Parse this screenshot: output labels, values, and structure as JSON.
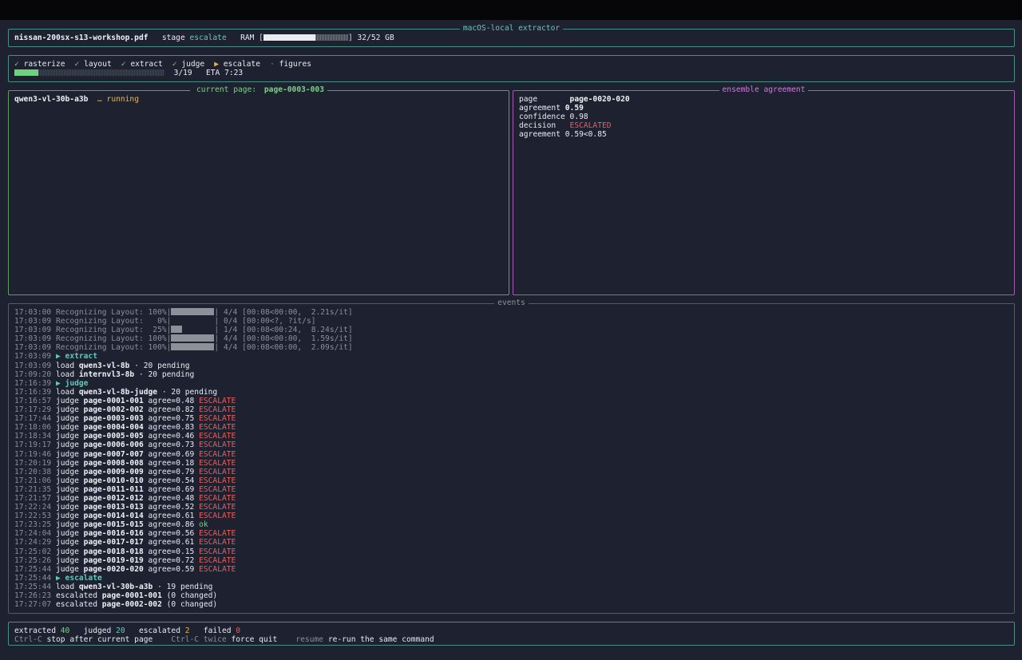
{
  "header": {
    "box_title": "macOS-local extractor",
    "filename": "nissan-200sx-s13-workshop.pdf",
    "stage_label": "stage",
    "stage_value": "escalate",
    "ram_label": "RAM",
    "ram_fraction": 0.615,
    "ram_text": "32/52 GB"
  },
  "stages": [
    {
      "mark": "✓",
      "name": "rasterize",
      "status": "done"
    },
    {
      "mark": "✓",
      "name": "layout",
      "status": "done"
    },
    {
      "mark": "✓",
      "name": "extract",
      "status": "done"
    },
    {
      "mark": "✓",
      "name": "judge",
      "status": "done"
    },
    {
      "mark": "▶",
      "name": "escalate",
      "status": "active"
    },
    {
      "mark": "·",
      "name": "figures",
      "status": "pending"
    }
  ],
  "progress": {
    "fraction": 0.158,
    "count": "3/19",
    "eta": "ETA 7:23"
  },
  "current": {
    "title_prefix": "current page:",
    "page": "page-0003-003",
    "model": "qwen3-vl-30b-a3b",
    "spinner": "…",
    "status": "running"
  },
  "ensemble": {
    "title": "ensemble agreement",
    "page_label": "page",
    "page_value": "page-0020-020",
    "agreement_label": "agreement",
    "agreement_value": "0.59",
    "confidence_label": "confidence",
    "confidence_value": "0.98",
    "decision_label": "decision",
    "decision_value": "ESCALATED",
    "threshold_label": "agreement",
    "threshold_value": "0.59<0.85"
  },
  "events": {
    "title": "events",
    "progress_lines": [
      {
        "time": "17:03:00",
        "label": "Recognizing Layout:",
        "pct": "100%",
        "fraction": 1.0,
        "tail": "4/4 [00:08<00:00,  2.21s/it]"
      },
      {
        "time": "17:03:09",
        "label": "Recognizing Layout:",
        "pct": "  0%",
        "fraction": 0.0,
        "tail": "0/4 [00:00<?, ?it/s]"
      },
      {
        "time": "17:03:09",
        "label": "Recognizing Layout:",
        "pct": " 25%",
        "fraction": 0.25,
        "tail": "1/4 [00:08<00:24,  8.24s/it]"
      },
      {
        "time": "17:03:09",
        "label": "Recognizing Layout:",
        "pct": "100%",
        "fraction": 1.0,
        "tail": "4/4 [00:08<00:00,  1.59s/it]"
      },
      {
        "time": "17:03:09",
        "label": "Recognizing Layout:",
        "pct": "100%",
        "fraction": 1.0,
        "tail": "4/4 [00:08<00:00,  2.09s/it]"
      }
    ],
    "log": [
      {
        "type": "stage",
        "time": "17:03:09",
        "text": "▶ extract"
      },
      {
        "type": "load",
        "time": "17:03:09",
        "model": "qwen3-vl-8b",
        "tail": "· 20 pending"
      },
      {
        "type": "load",
        "time": "17:09:20",
        "model": "internvl3-8b",
        "tail": "· 20 pending"
      },
      {
        "type": "stage",
        "time": "17:16:39",
        "text": "▶ judge"
      },
      {
        "type": "load",
        "time": "17:16:39",
        "model": "qwen3-vl-8b-judge",
        "tail": "· 20 pending"
      },
      {
        "type": "judge",
        "time": "17:16:57",
        "page": "page-0001-001",
        "agree": "agree=0.48",
        "verdict": "ESCALATE"
      },
      {
        "type": "judge",
        "time": "17:17:29",
        "page": "page-0002-002",
        "agree": "agree=0.82",
        "verdict": "ESCALATE"
      },
      {
        "type": "judge",
        "time": "17:17:44",
        "page": "page-0003-003",
        "agree": "agree=0.75",
        "verdict": "ESCALATE"
      },
      {
        "type": "judge",
        "time": "17:18:06",
        "page": "page-0004-004",
        "agree": "agree=0.83",
        "verdict": "ESCALATE"
      },
      {
        "type": "judge",
        "time": "17:18:34",
        "page": "page-0005-005",
        "agree": "agree=0.46",
        "verdict": "ESCALATE"
      },
      {
        "type": "judge",
        "time": "17:19:17",
        "page": "page-0006-006",
        "agree": "agree=0.73",
        "verdict": "ESCALATE"
      },
      {
        "type": "judge",
        "time": "17:19:46",
        "page": "page-0007-007",
        "agree": "agree=0.69",
        "verdict": "ESCALATE"
      },
      {
        "type": "judge",
        "time": "17:20:19",
        "page": "page-0008-008",
        "agree": "agree=0.18",
        "verdict": "ESCALATE"
      },
      {
        "type": "judge",
        "time": "17:20:38",
        "page": "page-0009-009",
        "agree": "agree=0.79",
        "verdict": "ESCALATE"
      },
      {
        "type": "judge",
        "time": "17:21:06",
        "page": "page-0010-010",
        "agree": "agree=0.54",
        "verdict": "ESCALATE"
      },
      {
        "type": "judge",
        "time": "17:21:35",
        "page": "page-0011-011",
        "agree": "agree=0.69",
        "verdict": "ESCALATE"
      },
      {
        "type": "judge",
        "time": "17:21:57",
        "page": "page-0012-012",
        "agree": "agree=0.48",
        "verdict": "ESCALATE"
      },
      {
        "type": "judge",
        "time": "17:22:24",
        "page": "page-0013-013",
        "agree": "agree=0.52",
        "verdict": "ESCALATE"
      },
      {
        "type": "judge",
        "time": "17:22:53",
        "page": "page-0014-014",
        "agree": "agree=0.61",
        "verdict": "ESCALATE"
      },
      {
        "type": "judge",
        "time": "17:23:25",
        "page": "page-0015-015",
        "agree": "agree=0.86",
        "verdict": "ok"
      },
      {
        "type": "judge",
        "time": "17:24:04",
        "page": "page-0016-016",
        "agree": "agree=0.56",
        "verdict": "ESCALATE"
      },
      {
        "type": "judge",
        "time": "17:24:29",
        "page": "page-0017-017",
        "agree": "agree=0.61",
        "verdict": "ESCALATE"
      },
      {
        "type": "judge",
        "time": "17:25:02",
        "page": "page-0018-018",
        "agree": "agree=0.15",
        "verdict": "ESCALATE"
      },
      {
        "type": "judge",
        "time": "17:25:26",
        "page": "page-0019-019",
        "agree": "agree=0.72",
        "verdict": "ESCALATE"
      },
      {
        "type": "judge",
        "time": "17:25:44",
        "page": "page-0020-020",
        "agree": "agree=0.59",
        "verdict": "ESCALATE"
      },
      {
        "type": "stage",
        "time": "17:25:44",
        "text": "▶ escalate"
      },
      {
        "type": "load",
        "time": "17:25:44",
        "model": "qwen3-vl-30b-a3b",
        "tail": "· 19 pending"
      },
      {
        "type": "escalated",
        "time": "17:26:23",
        "page": "page-0001-001",
        "tail": "(0 changed)"
      },
      {
        "type": "escalated",
        "time": "17:27:07",
        "page": "page-0002-002",
        "tail": "(0 changed)"
      }
    ]
  },
  "footer": {
    "extracted_label": "extracted",
    "extracted_value": "40",
    "judged_label": "judged",
    "judged_value": "20",
    "escalated_label": "escalated",
    "escalated_value": "2",
    "failed_label": "failed",
    "failed_value": "0",
    "hint1_key": "Ctrl-C",
    "hint1_text": "stop after current page",
    "hint2_key": "Ctrl-C twice",
    "hint2_text": "force quit",
    "hint3_key": "resume",
    "hint3_text": "re-run the same command"
  },
  "colors": {
    "background": "#1e2230",
    "teal": "#66c6bd",
    "green": "#7fcf8b",
    "yellow": "#e2b65a",
    "red": "#e0615e",
    "purple": "#c77fd6"
  }
}
